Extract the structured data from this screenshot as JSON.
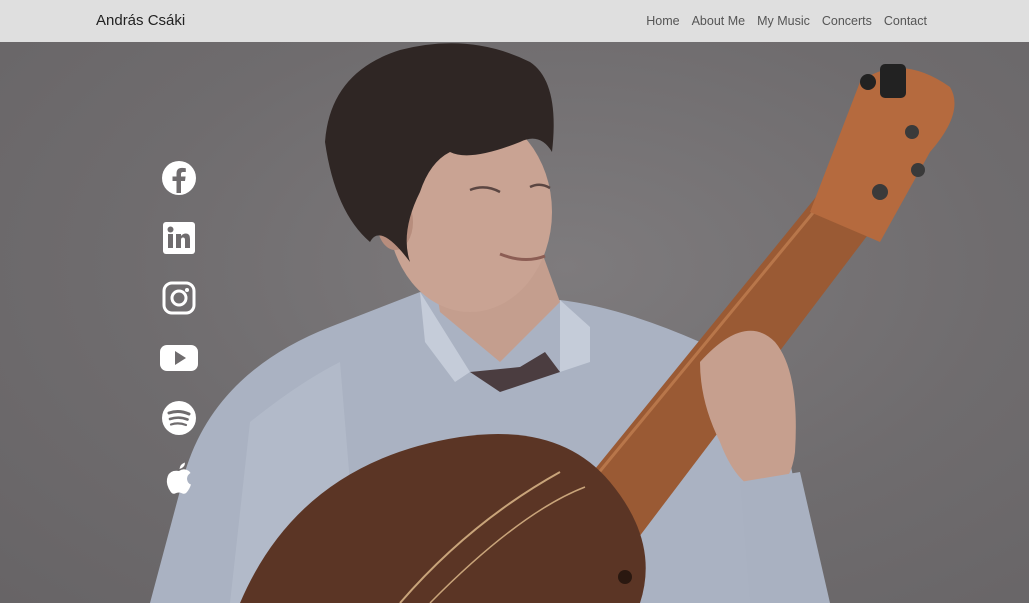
{
  "navbar": {
    "brand": "András Csáki",
    "links": [
      {
        "label": "Home"
      },
      {
        "label": "About Me"
      },
      {
        "label": "My Music"
      },
      {
        "label": "Concerts"
      },
      {
        "label": "Contact"
      }
    ]
  },
  "hero": {
    "social_icons": [
      "facebook-icon",
      "linkedin-icon",
      "instagram-icon",
      "youtube-icon",
      "spotify-icon",
      "apple-icon"
    ]
  },
  "colors": {
    "navbar_bg": "#dfdfdf",
    "hero_bg": "#6f6c6e",
    "icon": "#ffffff"
  }
}
